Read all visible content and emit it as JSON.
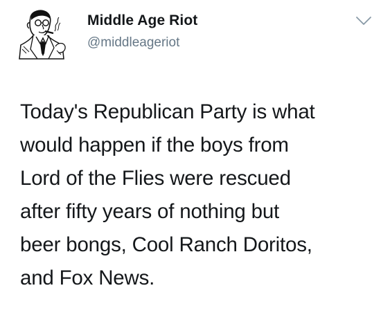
{
  "tweet": {
    "author": {
      "name": "Middle Age Riot",
      "handle": "@middleageriot",
      "avatar_icon": "vintage-man-with-cigar-illustration"
    },
    "menu_icon": "chevron-down-icon",
    "text_lines": [
      "Today's Republican Party is what",
      "would happen if the boys from",
      "Lord of the Flies were rescued",
      "after fifty years of nothing but",
      "beer bongs, Cool Ranch Doritos,",
      "and Fox News."
    ]
  },
  "colors": {
    "name": "#14171a",
    "handle": "#657786",
    "chevron": "#8899a6",
    "background": "#ffffff"
  }
}
